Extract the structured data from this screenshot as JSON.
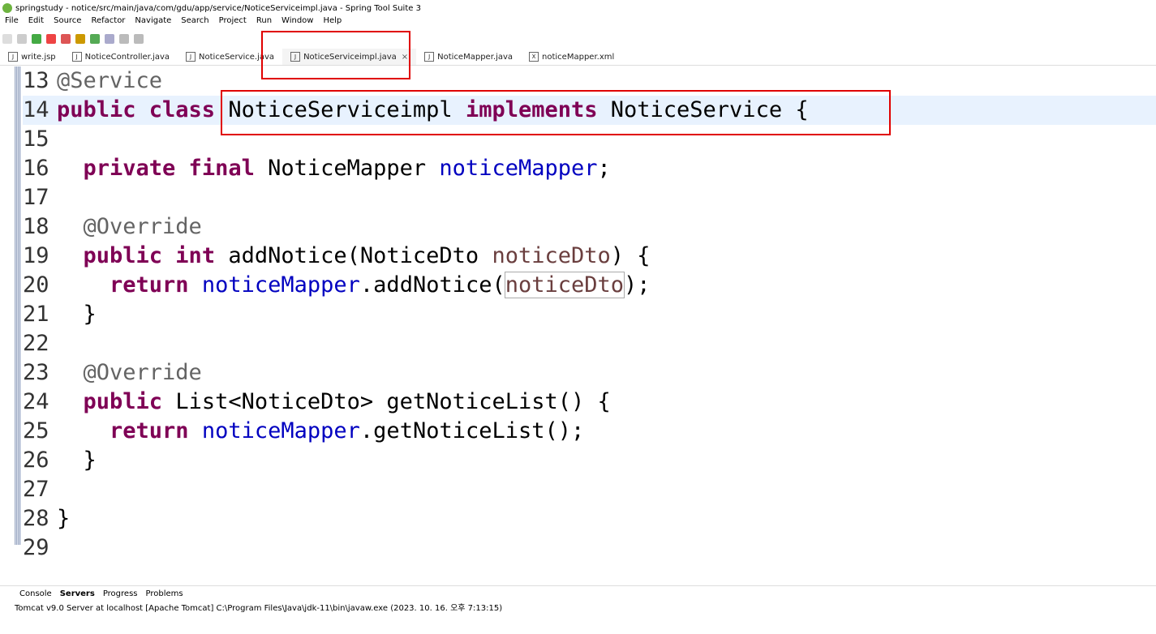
{
  "window": {
    "title": "springstudy - notice/src/main/java/com/gdu/app/service/NoticeServiceimpl.java - Spring Tool Suite 3"
  },
  "menu": [
    "File",
    "Edit",
    "Source",
    "Refactor",
    "Navigate",
    "Search",
    "Project",
    "Run",
    "Window",
    "Help"
  ],
  "tabs": [
    {
      "label": "write.jsp",
      "icon": "jsp-file-icon"
    },
    {
      "label": "NoticeController.java",
      "icon": "java-file-icon"
    },
    {
      "label": "NoticeService.java",
      "icon": "java-file-icon"
    },
    {
      "label": "NoticeServiceimpl.java",
      "icon": "java-file-icon",
      "active": true
    },
    {
      "label": "NoticeMapper.java",
      "icon": "java-file-icon"
    },
    {
      "label": "noticeMapper.xml",
      "icon": "xml-file-icon"
    }
  ],
  "editor": {
    "lines": [
      {
        "num": "13",
        "text": "@Service"
      },
      {
        "num": "14",
        "text": "public class NoticeServiceimpl implements NoticeService {"
      },
      {
        "num": "15",
        "text": ""
      },
      {
        "num": "16",
        "text": "  private final NoticeMapper noticeMapper;"
      },
      {
        "num": "17",
        "text": ""
      },
      {
        "num": "18",
        "text": "  @Override"
      },
      {
        "num": "19",
        "text": "  public int addNotice(NoticeDto noticeDto) {"
      },
      {
        "num": "20",
        "text": "    return noticeMapper.addNotice(noticeDto);"
      },
      {
        "num": "21",
        "text": "  }"
      },
      {
        "num": "22",
        "text": ""
      },
      {
        "num": "23",
        "text": "  @Override"
      },
      {
        "num": "24",
        "text": "  public List<NoticeDto> getNoticeList() {"
      },
      {
        "num": "25",
        "text": "    return noticeMapper.getNoticeList();"
      },
      {
        "num": "26",
        "text": "  }"
      },
      {
        "num": "27",
        "text": ""
      },
      {
        "num": "28",
        "text": "}"
      },
      {
        "num": "29",
        "text": ""
      }
    ]
  },
  "bottom": {
    "tabs": [
      "Console",
      "Servers",
      "Progress",
      "Problems"
    ],
    "status": "Tomcat v9.0 Server at localhost [Apache Tomcat] C:\\Program Files\\Java\\jdk-11\\bin\\javaw.exe  (2023. 10. 16. 오후 7:13:15)"
  },
  "colors": {
    "highlight_box": "#e00000",
    "keyword": "#7f0055",
    "field": "#0000c0"
  }
}
